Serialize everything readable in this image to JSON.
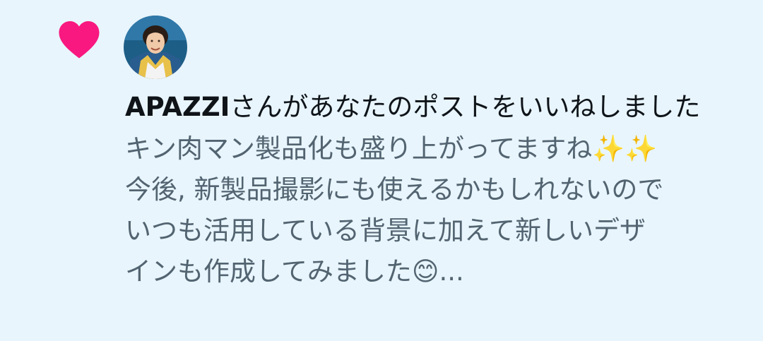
{
  "notification": {
    "type_icon": "heart-icon",
    "type_icon_color": "#f91880",
    "avatar_alt": "APAZZI",
    "username": "APAZZI",
    "action_text": "さんがあなたのポストをいいねしました",
    "post_preview": "キン肉マン製品化も盛り上がってますね✨✨\n今後, 新製品撮影にも使えるかもしれないので\nいつも活用している背景に加えて新しいデザ\nインも作成してみました😊..."
  }
}
